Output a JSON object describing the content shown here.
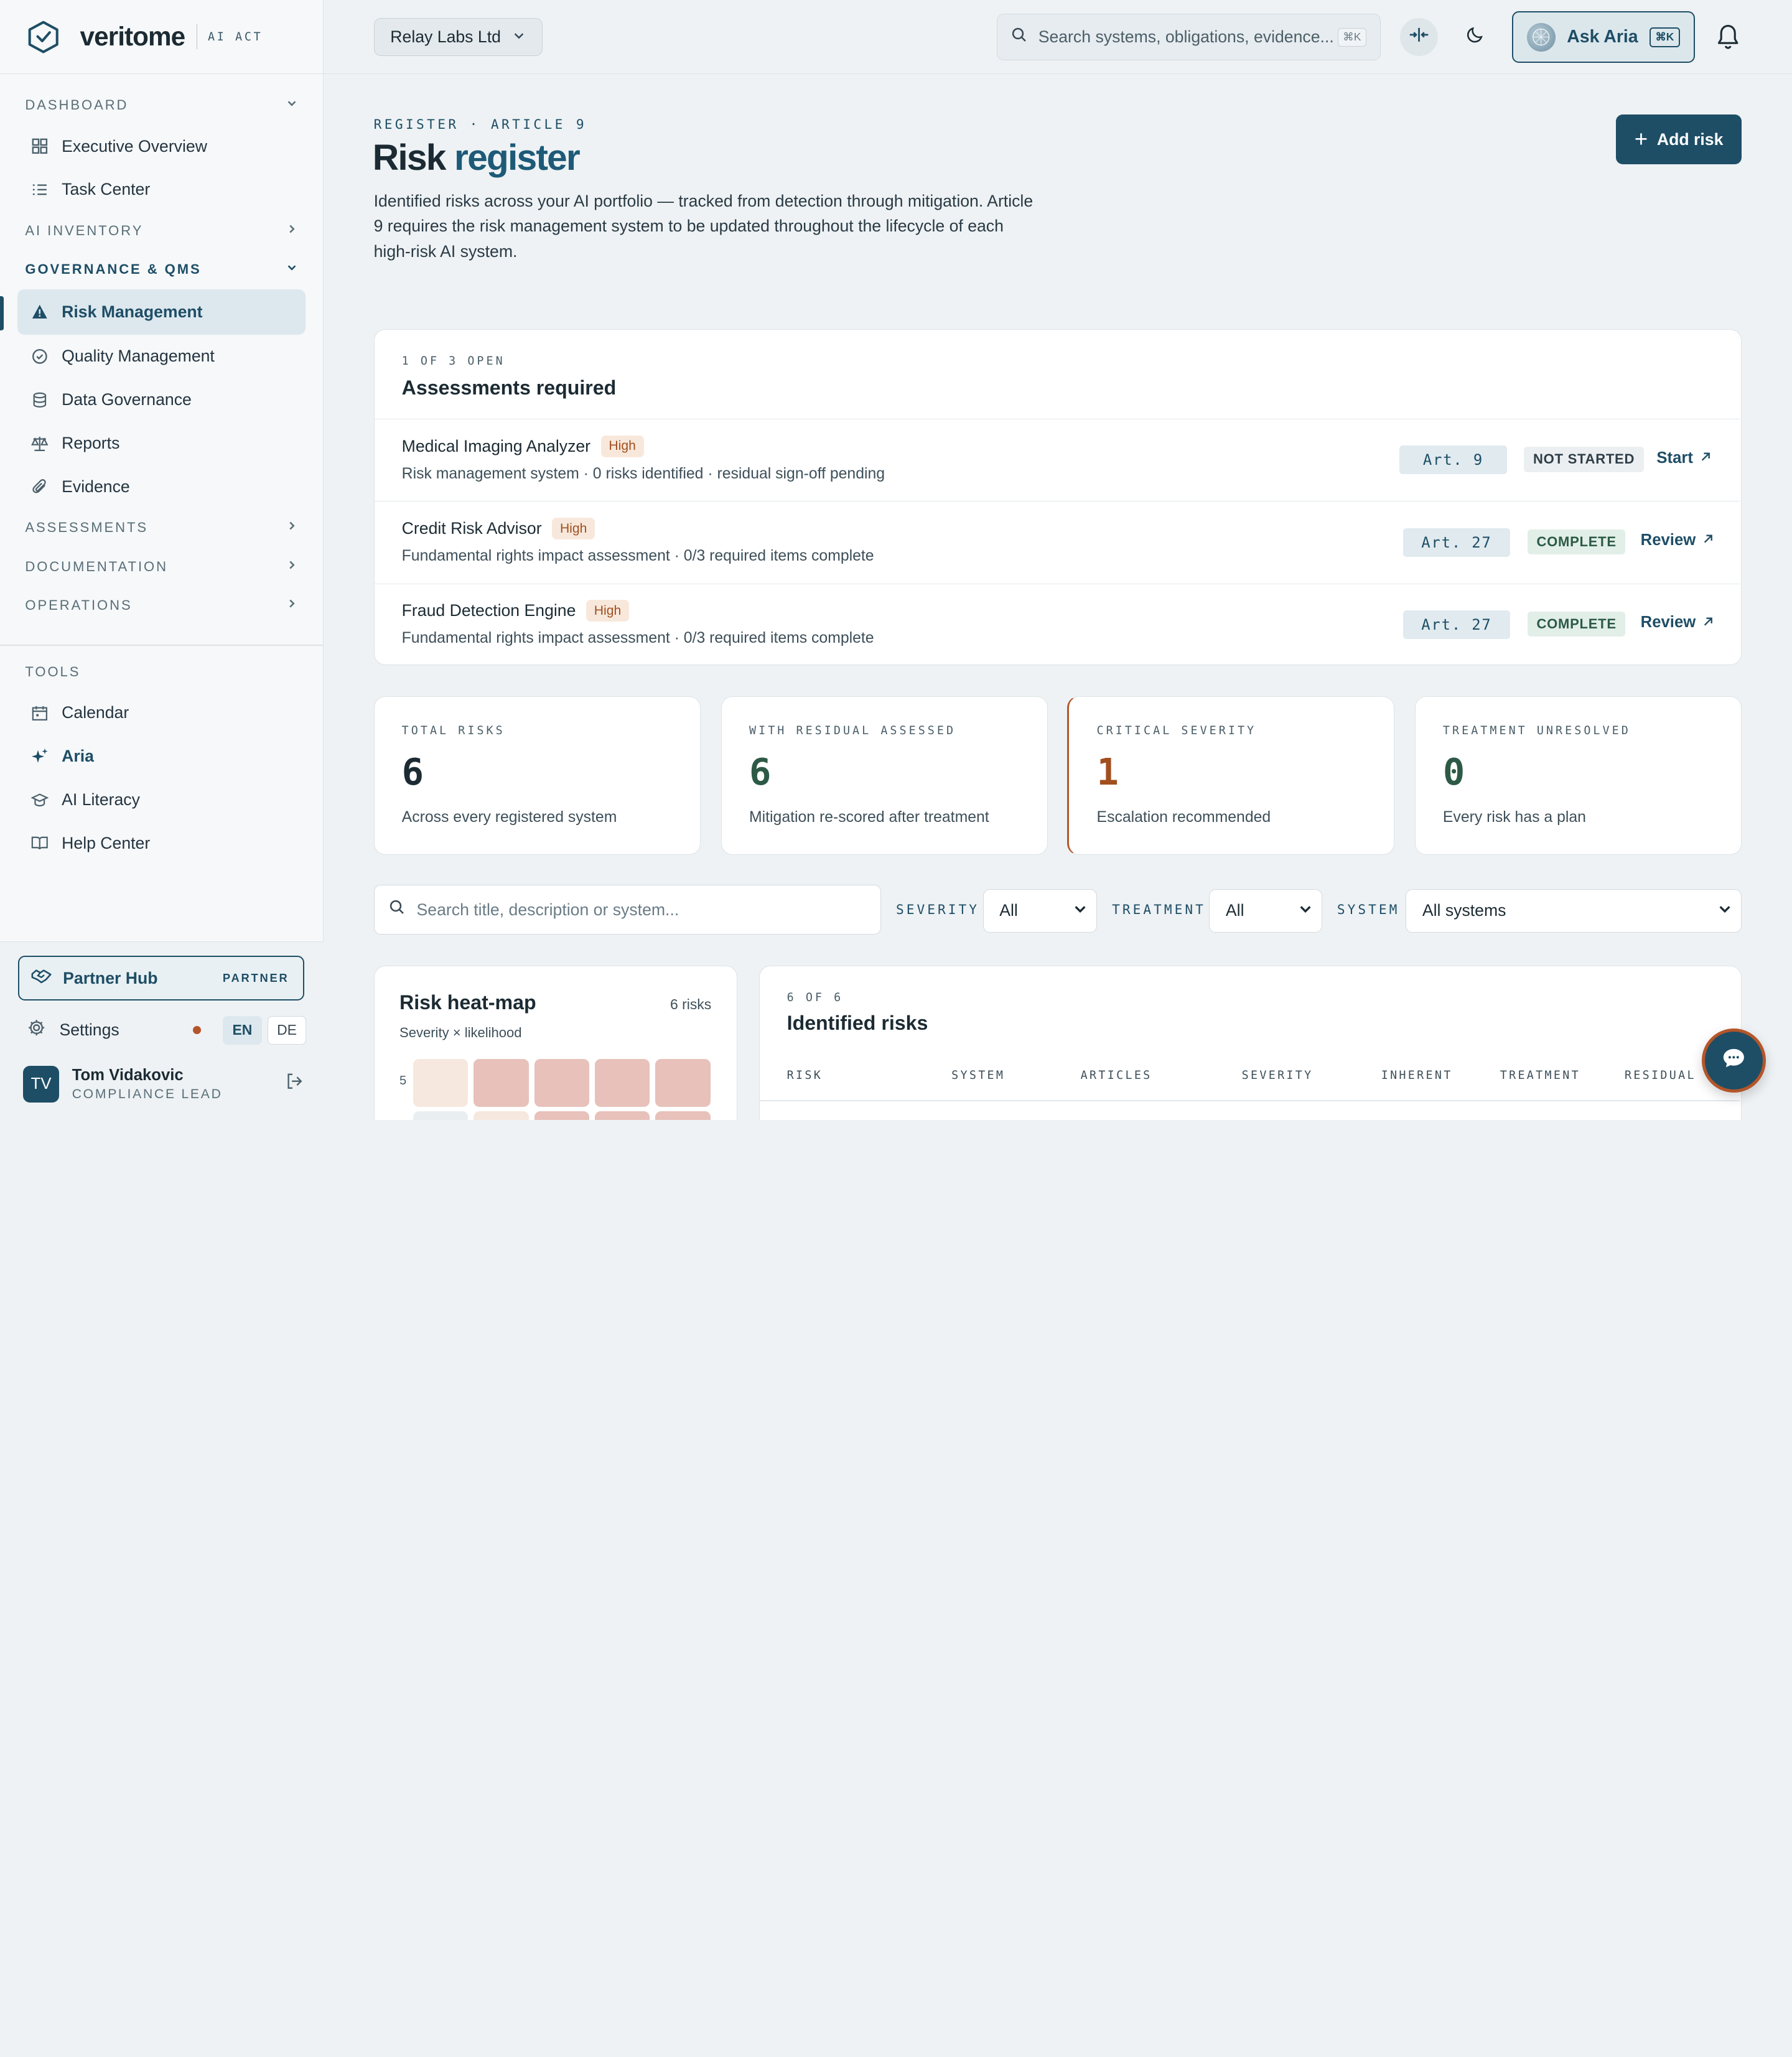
{
  "brand": {
    "name": "veritome",
    "product": "AI ACT"
  },
  "sidebar": {
    "sections": {
      "dashboard": "DASHBOARD",
      "ai_inventory": "AI INVENTORY",
      "governance": "GOVERNANCE & QMS",
      "assessments": "ASSESSMENTS",
      "documentation": "DOCUMENTATION",
      "operations": "OPERATIONS",
      "tools": "TOOLS"
    },
    "dashboard_items": [
      {
        "label": "Executive Overview",
        "icon": "grid-icon"
      },
      {
        "label": "Task Center",
        "icon": "list-icon"
      }
    ],
    "governance_items": [
      {
        "label": "Risk Management",
        "icon": "warning-icon",
        "active": true
      },
      {
        "label": "Quality Management",
        "icon": "badge-check-icon"
      },
      {
        "label": "Data Governance",
        "icon": "database-icon"
      },
      {
        "label": "Reports",
        "icon": "scale-icon"
      },
      {
        "label": "Evidence",
        "icon": "paperclip-icon"
      }
    ],
    "tools_items": [
      {
        "label": "Calendar",
        "icon": "calendar-icon"
      },
      {
        "label": "Aria",
        "icon": "sparkle-icon"
      },
      {
        "label": "AI Literacy",
        "icon": "graduation-cap-icon"
      },
      {
        "label": "Help Center",
        "icon": "book-icon"
      }
    ],
    "partner_hub": {
      "label": "Partner Hub",
      "tag": "PARTNER"
    },
    "settings": "Settings",
    "languages": [
      "EN",
      "DE"
    ],
    "active_language": "EN",
    "user": {
      "initials": "TV",
      "name": "Tom Vidakovic",
      "role": "COMPLIANCE LEAD"
    }
  },
  "topbar": {
    "org": "Relay Labs Ltd",
    "search_placeholder": "Search systems, obligations, evidence...",
    "search_shortcut": "⌘K",
    "ask_label": "Ask Aria",
    "ask_shortcut": "⌘K"
  },
  "page": {
    "eyebrow": "REGISTER · ARTICLE 9",
    "title_main": "Risk",
    "title_accent": "register",
    "description": "Identified risks across your AI portfolio — tracked from detection through mitigation. Article 9 requires the risk management system to be updated throughout the lifecycle of each high-risk AI system.",
    "add_button": "Add risk"
  },
  "assessments": {
    "eyebrow": "1 OF 3 OPEN",
    "title": "Assessments required",
    "rows": [
      {
        "name": "Medical Imaging Analyzer",
        "level": "High",
        "detail": "Risk management system · 0 risks identified · residual sign-off pending",
        "article": "Art. 9",
        "status": "NOT STARTED",
        "action": "Start"
      },
      {
        "name": "Credit Risk Advisor",
        "level": "High",
        "detail": "Fundamental rights impact assessment · 0/3 required items complete",
        "article": "Art. 27",
        "status": "COMPLETE",
        "action": "Review"
      },
      {
        "name": "Fraud Detection Engine",
        "level": "High",
        "detail": "Fundamental rights impact assessment · 0/3 required items complete",
        "article": "Art. 27",
        "status": "COMPLETE",
        "action": "Review"
      }
    ]
  },
  "stats": [
    {
      "label": "TOTAL RISKS",
      "value": "6",
      "desc": "Across every registered system",
      "color": "#1c2b33"
    },
    {
      "label": "WITH RESIDUAL ASSESSED",
      "value": "6",
      "desc": "Mitigation re-scored after treatment",
      "color": "#2d5a46"
    },
    {
      "label": "CRITICAL SEVERITY",
      "value": "1",
      "desc": "Escalation recommended",
      "color": "#a14f1e"
    },
    {
      "label": "TREATMENT UNRESOLVED",
      "value": "0",
      "desc": "Every risk has a plan",
      "color": "#2d5a46"
    }
  ],
  "filters": {
    "search_placeholder": "Search title, description or system...",
    "severity_label": "SEVERITY",
    "severity_value": "All",
    "treatment_label": "TREATMENT",
    "treatment_value": "All",
    "system_label": "SYSTEM",
    "system_value": "All systems"
  },
  "heatmap": {
    "title": "Risk heat-map",
    "count": "6 risks",
    "subtitle": "Severity × likelihood",
    "row_label": "5",
    "colors": {
      "light": "#f6e8de",
      "mid": "#e7c1ba",
      "pale": "#e9eef1"
    }
  },
  "risks_table": {
    "eyebrow": "6 OF 6",
    "title": "Identified risks",
    "columns": [
      "RISK",
      "SYSTEM",
      "ARTICLES",
      "SEVERITY",
      "INHERENT",
      "TREATMENT",
      "RESIDUAL"
    ]
  },
  "colors": {
    "accent": "#1e4e66",
    "warning": "#b4562a"
  }
}
